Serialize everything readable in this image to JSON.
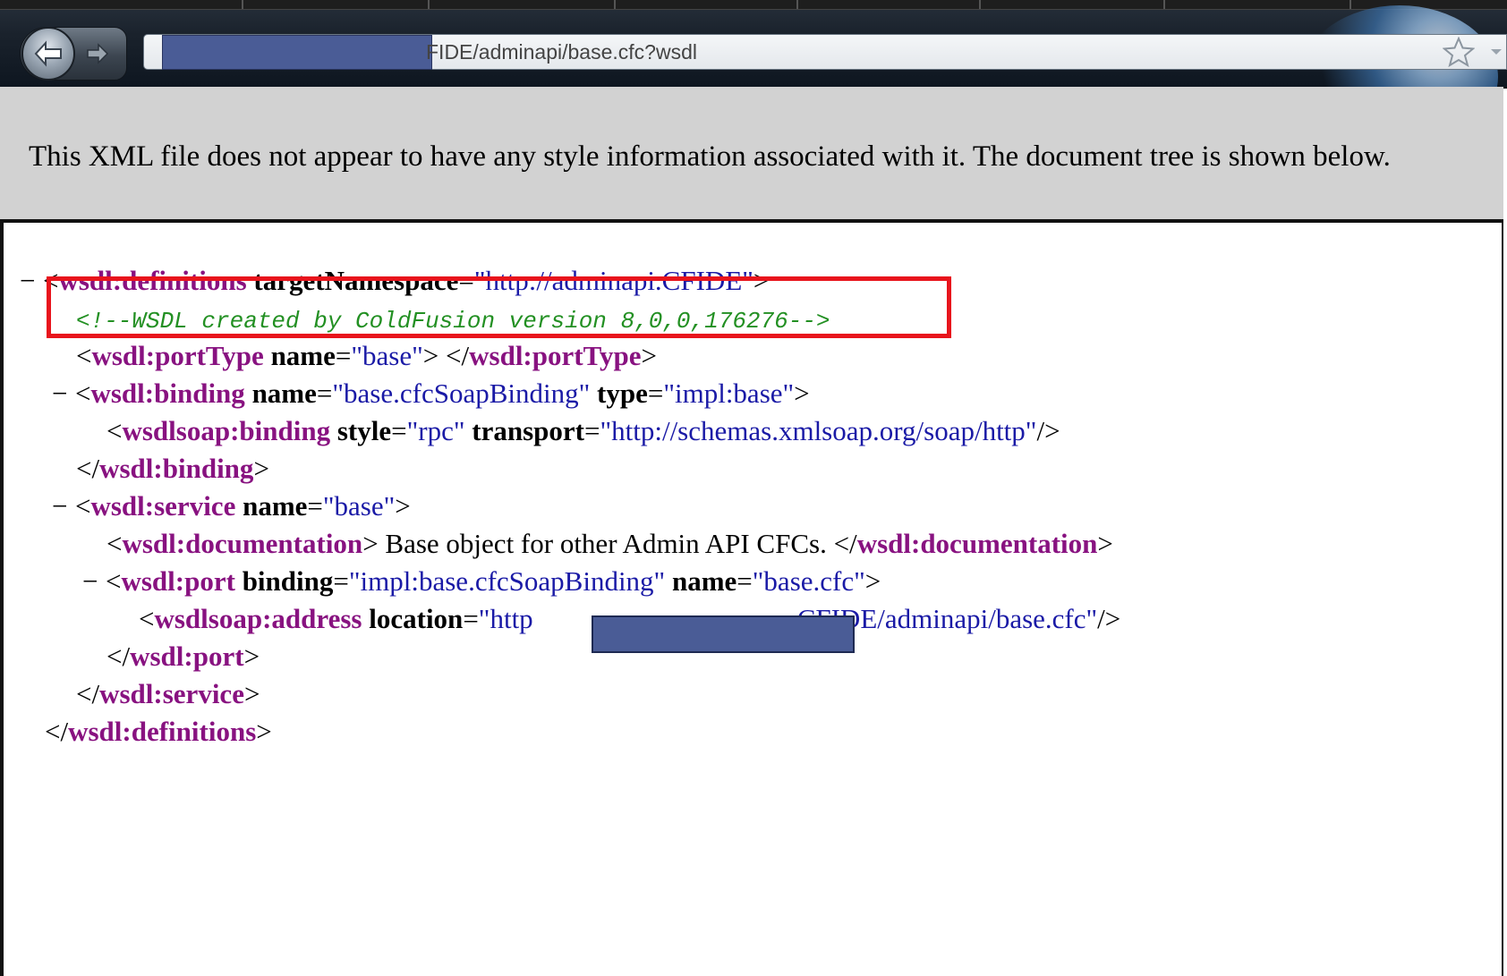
{
  "browser": {
    "url_text": "FIDE/adminapi/base.cfc?wsdl"
  },
  "banner": {
    "text": "This XML file does not appear to have any style information associated with it. The document tree is shown below."
  },
  "xml": {
    "collapse_glyph": "−",
    "definitions": {
      "tag": "wsdl:definitions",
      "attr": "targetNamespace",
      "value": "\"http://adminapi.CFIDE\""
    },
    "comment": "<!--WSDL created by ColdFusion version 8,0,0,176276-->",
    "porttype": {
      "tag": "wsdl:portType",
      "attr": "name",
      "value": "\"base\"",
      "close_tag": "wsdl:portType"
    },
    "binding": {
      "tag": "wsdl:binding",
      "attr1": "name",
      "value1": "\"base.cfcSoapBinding\"",
      "attr2": "type",
      "value2": "\"impl:base\"",
      "close_tag": "wsdl:binding"
    },
    "soap_binding": {
      "tag": "wsdlsoap:binding",
      "attr1": "style",
      "value1": "\"rpc\"",
      "attr2": "transport",
      "value2": "\"http://schemas.xmlsoap.org/soap/http\""
    },
    "service": {
      "tag": "wsdl:service",
      "attr": "name",
      "value": "\"base\"",
      "close_tag": "wsdl:service"
    },
    "documentation": {
      "tag": "wsdl:documentation",
      "text": " Base object for other Admin API CFCs. ",
      "close_tag": "wsdl:documentation"
    },
    "port": {
      "tag": "wsdl:port",
      "attr1": "binding",
      "value1": "\"impl:base.cfcSoapBinding\"",
      "attr2": "name",
      "value2": "\"base.cfc\"",
      "close_tag": "wsdl:port"
    },
    "address": {
      "tag": "wsdlsoap:address",
      "attr": "location",
      "value_start": "\"http",
      "value_end": "CFIDE/adminapi/base.cfc\""
    },
    "close_definitions": "wsdl:definitions"
  },
  "icons": {
    "back": "back-arrow-icon",
    "forward": "forward-arrow-icon",
    "star": "star-icon",
    "dropdown": "chevron-down-icon"
  },
  "colors": {
    "tag": "#881280",
    "value": "#1a1aa6",
    "comment": "#239023",
    "highlight": "#e8141c",
    "redaction": "#4a5c96"
  }
}
